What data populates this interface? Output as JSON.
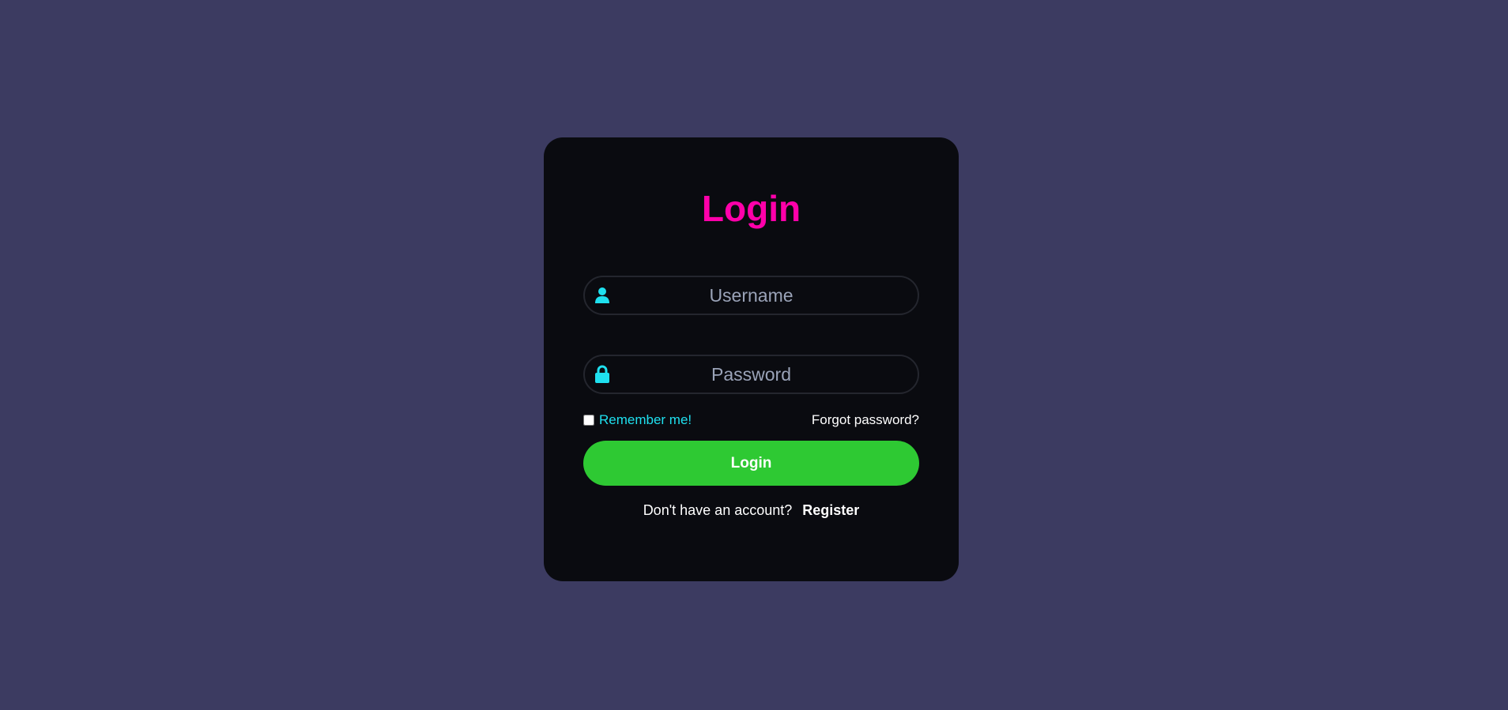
{
  "page": {
    "background": "#3c3b61"
  },
  "card": {
    "background": "#0a0b10",
    "title": "Login",
    "title_color": "#ff00aa"
  },
  "username": {
    "placeholder": "Username",
    "value": "",
    "icon": "user-icon"
  },
  "password": {
    "placeholder": "Password",
    "value": "",
    "icon": "lock-icon"
  },
  "options": {
    "remember_label": "Remember me!",
    "remember_checked": false,
    "forgot_label": "Forgot password?"
  },
  "login_button": {
    "label": "Login",
    "color": "#2ec933"
  },
  "register": {
    "prompt": "Don't have an account?",
    "link_label": "Register"
  },
  "accent_color": "#1fe0ef"
}
